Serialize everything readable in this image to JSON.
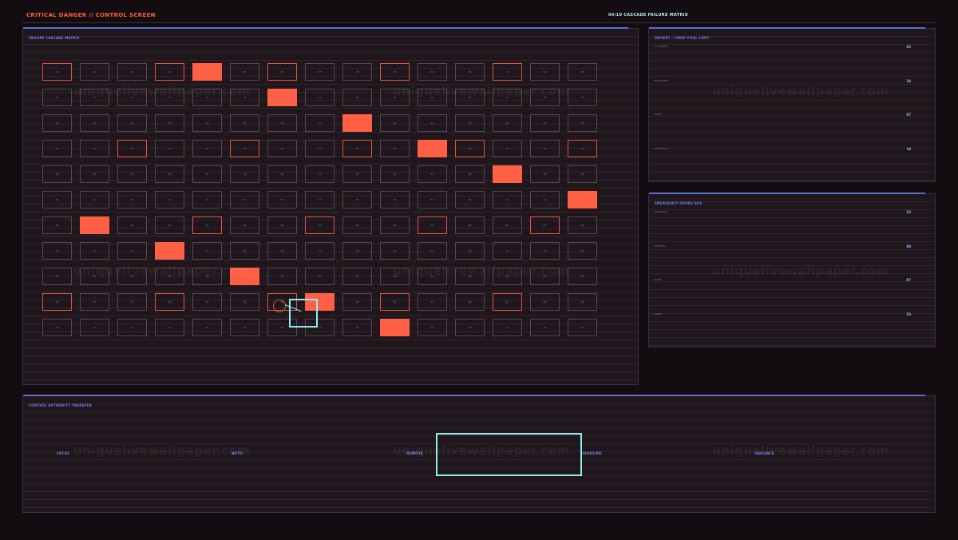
{
  "header": {
    "title": "CRITICAL DANGER // CONTROL SCREEN",
    "step": "04/10  CASCADE FAILURE MATRIX"
  },
  "matrix": {
    "title": "FAILURE CASCADE MATRIX",
    "cols": 15,
    "rows": [
      [
        "00",
        "01",
        "02",
        "03",
        "04",
        "05",
        "06",
        "07",
        "08",
        "09",
        "0A",
        "0B",
        "0C",
        "0D",
        "0E"
      ],
      [
        "10",
        "11",
        "12",
        "13",
        "14",
        "15",
        "16",
        "17",
        "18",
        "19",
        "1A",
        "1B",
        "1C",
        "1D",
        "1E"
      ],
      [
        "20",
        "21",
        "22",
        "23",
        "24",
        "25",
        "26",
        "27",
        "28",
        "29",
        "2A",
        "2B",
        "2C",
        "2D",
        "2E"
      ],
      [
        "30",
        "31",
        "32",
        "33",
        "34",
        "35",
        "36",
        "37",
        "38",
        "39",
        "3A",
        "3B",
        "3C",
        "3D",
        "3E"
      ],
      [
        "40",
        "41",
        "42",
        "43",
        "44",
        "45",
        "46",
        "47",
        "48",
        "49",
        "4A",
        "4B",
        "4C",
        "4D",
        "4E"
      ],
      [
        "50",
        "51",
        "52",
        "53",
        "54",
        "55",
        "56",
        "57",
        "58",
        "59",
        "5A",
        "5B",
        "5C",
        "5D",
        "5E"
      ],
      [
        "60",
        "61",
        "62",
        "63",
        "64",
        "65",
        "66",
        "67",
        "68",
        "69",
        "6A",
        "6B",
        "6C",
        "6D",
        "6E"
      ],
      [
        "70",
        "71",
        "72",
        "73",
        "74",
        "75",
        "76",
        "77",
        "78",
        "79",
        "7A",
        "7B",
        "7C",
        "7D",
        "7E"
      ],
      [
        "80",
        "81",
        "82",
        "83",
        "84",
        "85",
        "86",
        "87",
        "88",
        "89",
        "8A",
        "8B",
        "8C",
        "8D",
        "8E"
      ],
      [
        "90",
        "91",
        "92",
        "93",
        "94",
        "95",
        "96",
        "97",
        "98",
        "99",
        "9A",
        "9B",
        "9C",
        "9D",
        "9E"
      ],
      [
        "A0",
        "A1",
        "A2",
        "A3",
        "A4",
        "A5",
        "A6",
        "A7",
        "A8",
        "A9",
        "AA",
        "AB",
        "AC",
        "AD",
        "AE"
      ]
    ],
    "states": [
      [
        "warn",
        "normal",
        "normal",
        "warn",
        "fail",
        "normal",
        "warn",
        "normal",
        "normal",
        "warn",
        "normal",
        "normal",
        "warn",
        "normal",
        "normal"
      ],
      [
        "normal",
        "normal",
        "normal",
        "normal",
        "normal",
        "normal",
        "fail",
        "normal",
        "normal",
        "normal",
        "normal",
        "normal",
        "normal",
        "normal",
        "normal"
      ],
      [
        "normal",
        "normal",
        "normal",
        "normal",
        "normal",
        "normal",
        "normal",
        "normal",
        "fail",
        "normal",
        "normal",
        "normal",
        "normal",
        "normal",
        "normal"
      ],
      [
        "normal",
        "normal",
        "warn",
        "normal",
        "normal",
        "warn",
        "normal",
        "normal",
        "warn",
        "normal",
        "fail",
        "warn",
        "normal",
        "normal",
        "warn"
      ],
      [
        "normal",
        "normal",
        "normal",
        "normal",
        "normal",
        "normal",
        "normal",
        "normal",
        "normal",
        "normal",
        "normal",
        "normal",
        "fail",
        "normal",
        "normal"
      ],
      [
        "normal",
        "normal",
        "normal",
        "normal",
        "normal",
        "normal",
        "normal",
        "normal",
        "normal",
        "normal",
        "normal",
        "normal",
        "normal",
        "normal",
        "fail"
      ],
      [
        "normal",
        "fail",
        "normal",
        "normal",
        "warn",
        "normal",
        "normal",
        "warn",
        "normal",
        "normal",
        "warn",
        "normal",
        "normal",
        "warn",
        "normal"
      ],
      [
        "normal",
        "normal",
        "normal",
        "fail",
        "normal",
        "normal",
        "normal",
        "normal",
        "normal",
        "normal",
        "normal",
        "normal",
        "normal",
        "normal",
        "normal"
      ],
      [
        "normal",
        "normal",
        "normal",
        "normal",
        "normal",
        "fail",
        "normal",
        "normal",
        "normal",
        "normal",
        "normal",
        "normal",
        "normal",
        "normal",
        "normal"
      ],
      [
        "warn",
        "normal",
        "normal",
        "warn",
        "normal",
        "normal",
        "warn",
        "fail",
        "normal",
        "warn",
        "normal",
        "normal",
        "warn",
        "normal",
        "normal"
      ],
      [
        "normal",
        "normal",
        "normal",
        "normal",
        "normal",
        "normal",
        "normal",
        "normal",
        "normal",
        "fail",
        "normal",
        "normal",
        "normal",
        "normal",
        "normal"
      ]
    ]
  },
  "vitals": {
    "title": "PATIENT / CREW VITAL LIMIT",
    "items": [
      {
        "label": "O2 SPREAD",
        "value": "83"
      },
      {
        "label": "HEART RATE",
        "value": "34"
      },
      {
        "label": "PULSE",
        "value": "97"
      },
      {
        "label": "CONSCIOUS",
        "value": "18"
      }
    ]
  },
  "doors": {
    "title": "EMERGENCY DOORS BUS",
    "items": [
      {
        "label": "MAINDOOR",
        "value": "23"
      },
      {
        "label": "OPTIONAL",
        "value": "88"
      },
      {
        "label": "VALVE",
        "value": "97"
      },
      {
        "label": "FORCE",
        "value": "53"
      }
    ]
  },
  "authority": {
    "title": "CONTROL AUTHORITY TRANSFER",
    "options": [
      "LOCAL",
      "AUTO",
      "REMOTE",
      "HARDLINE",
      "FAILSAFE"
    ]
  },
  "watermark": "uniquelivewallpaper.com",
  "colors": {
    "fail": "#ff5f45",
    "accent": "#5a6dd0",
    "cursor": "#8ff0f0",
    "background": "#130c10"
  }
}
